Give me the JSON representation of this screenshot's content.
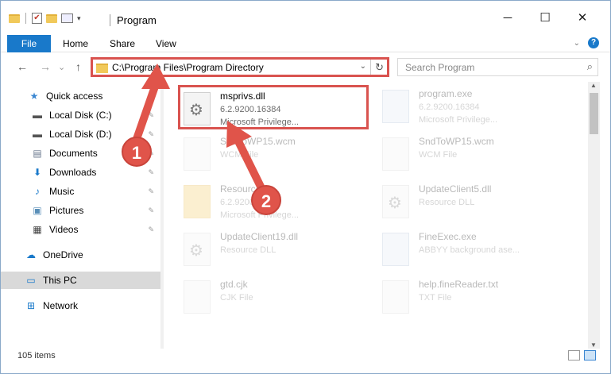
{
  "window": {
    "title": "Program",
    "controls": {
      "minimize": "─",
      "maximize": "☐",
      "close": "✕"
    }
  },
  "ribbon": {
    "tabs": [
      {
        "label": "File",
        "active": true
      },
      {
        "label": "Home"
      },
      {
        "label": "Share"
      },
      {
        "label": "View"
      }
    ],
    "accent_color": "#1979ca"
  },
  "navigation": {
    "back": "←",
    "forward": "→",
    "recent": "⌄",
    "up": "↑",
    "address": "C:\\Program Files\\Program Directory",
    "refresh": "↻",
    "search_placeholder": "Search Program"
  },
  "sidebar": {
    "items": [
      {
        "label": "Quick access",
        "icon": "star-icon",
        "glyph": "★",
        "color": "#3a86d1"
      },
      {
        "label": "Local Disk (C:)",
        "icon": "drive-icon",
        "glyph": "▬",
        "color": "#555",
        "pinned": true
      },
      {
        "label": "Local Disk (D:)",
        "icon": "drive-icon",
        "glyph": "▬",
        "color": "#555",
        "pinned": true
      },
      {
        "label": "Documents",
        "icon": "documents-icon",
        "glyph": "▤",
        "color": "#6b7a8f",
        "pinned": true
      },
      {
        "label": "Downloads",
        "icon": "download-icon",
        "glyph": "⬇",
        "color": "#1979ca",
        "pinned": true
      },
      {
        "label": "Music",
        "icon": "music-icon",
        "glyph": "♪",
        "color": "#1979ca",
        "pinned": true
      },
      {
        "label": "Pictures",
        "icon": "pictures-icon",
        "glyph": "▣",
        "color": "#5a8fb8",
        "pinned": true
      },
      {
        "label": "Videos",
        "icon": "videos-icon",
        "glyph": "▦",
        "color": "#444",
        "pinned": true
      },
      {
        "label": "OneDrive",
        "icon": "cloud-icon",
        "glyph": "☁",
        "color": "#1979ca"
      },
      {
        "label": "This PC",
        "icon": "computer-icon",
        "glyph": "▭",
        "color": "#1979ca",
        "selected": true
      },
      {
        "label": "Network",
        "icon": "network-icon",
        "glyph": "⊞",
        "color": "#1979ca"
      }
    ],
    "pin_glyph": "📌"
  },
  "files": [
    {
      "name": "msprivs.dll",
      "line1": "6.2.9200.16384",
      "line2": "Microsoft Privilege...",
      "icon": "dll-icon",
      "type": "dll",
      "highlighted": true
    },
    {
      "name": "program.exe",
      "line1": "6.2.9200.16384",
      "line2": "Microsoft Privilege...",
      "icon": "exe-icon",
      "type": "exe"
    },
    {
      "name": "SndToWP15.wcm",
      "line1": "WCM File",
      "line2": "",
      "icon": "file-icon",
      "type": "blank"
    },
    {
      "name": "SndToWP15.wcm",
      "line1": "WCM File",
      "line2": "",
      "icon": "file-icon",
      "type": "blank"
    },
    {
      "name": "Resources",
      "line1": "6.2.9200.16384",
      "line2": "Microsoft Privilege...",
      "icon": "folder-icon",
      "type": "folder"
    },
    {
      "name": "UpdateClient5.dll",
      "line1": "Resource DLL",
      "line2": "",
      "icon": "dll-icon",
      "type": "dll"
    },
    {
      "name": "UpdateClient19.dll",
      "line1": "Resource DLL",
      "line2": "",
      "icon": "dll-icon",
      "type": "dll"
    },
    {
      "name": "FineExec.exe",
      "line1": "ABBYY background ase...",
      "line2": "",
      "icon": "exe-icon",
      "type": "exe"
    },
    {
      "name": "gtd.cjk",
      "line1": "CJK File",
      "line2": "",
      "icon": "file-icon",
      "type": "blank"
    },
    {
      "name": "help.fineReader.txt",
      "line1": "TXT File",
      "line2": "",
      "icon": "file-icon",
      "type": "blank"
    }
  ],
  "status": {
    "item_count": "105 items"
  },
  "annotations": [
    {
      "number": "1",
      "color": "#e0544a"
    },
    {
      "number": "2",
      "color": "#e0544a"
    }
  ]
}
